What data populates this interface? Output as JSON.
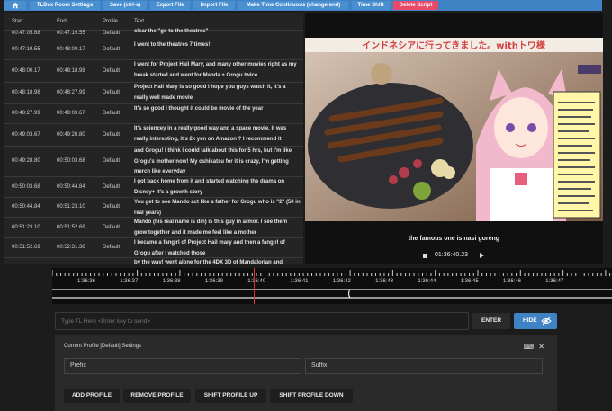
{
  "toolbar": {
    "home_icon": "home-icon",
    "buttons": [
      {
        "label": "TLDex Room Settings"
      },
      {
        "label": "Save (ctrl-s)"
      },
      {
        "label": "Export File"
      },
      {
        "label": "Import File"
      },
      {
        "label": "Make Time Continuous (change end)"
      },
      {
        "label": "Time Shift"
      },
      {
        "label": "Delete Script"
      }
    ],
    "delete_color": "#ea4a6a",
    "accent": "#3f83c4"
  },
  "table": {
    "headers": {
      "start": "Start",
      "end": "End",
      "profile": "Profile",
      "text": "Text"
    },
    "rows": [
      {
        "start": "00:47:05.68",
        "end": "00:47:19.55",
        "profile": "Default",
        "text": "clear the \"go to the theatres\""
      },
      {
        "start": "00:47:19.55",
        "end": "00:48:00.17",
        "profile": "Default",
        "text": "I went to the theatres 7 times!"
      },
      {
        "start": "00:48:00.17",
        "end": "00:48:18.98",
        "profile": "Default",
        "text": "I went for Project Hail Mary, and many other movies right as my break started and went for Manda + Grogu twice"
      },
      {
        "start": "00:48:18.98",
        "end": "00:48:27.99",
        "profile": "Default",
        "text": "Project Hail Mary is so good I hope you guys watch it, it's a really well made movie"
      },
      {
        "start": "00:48:27.99",
        "end": "00:49:03.67",
        "profile": "Default",
        "text": "It's so good I thought it could be movie of the year"
      },
      {
        "start": "00:49:03.67",
        "end": "00:49:28.80",
        "profile": "Default",
        "text": "It's sciencey in a really good way and a space movie. it was really interesting, it's 2k yen on Amazon ? I recommend it"
      },
      {
        "start": "00:49:28.80",
        "end": "00:50:03.68",
        "profile": "Default",
        "text": "and Grogu! I think I could talk about this for 5 hrs, but I'm like Grogu's mother now! My oshikatsu for it is crazy, I'm getting merch like everyday"
      },
      {
        "start": "00:50:03.68",
        "end": "00:50:44.84",
        "profile": "Default",
        "text": "I got back home from it and started watching the drama on Disney+ it's a growth story"
      },
      {
        "start": "00:50:44.84",
        "end": "00:51:23.10",
        "profile": "Default",
        "text": "You get to see Mando act like a father for Grogu who is \"2\" (50 in real years)"
      },
      {
        "start": "00:51:23.10",
        "end": "00:51:52.69",
        "profile": "Default",
        "text": "Mando (his real name is din) is this guy in armor. I see them grow together and it made me feel like a mother"
      },
      {
        "start": "00:51:52.69",
        "end": "00:52:31.38",
        "profile": "Default",
        "text": "I became a fangirl of Project Hail mary and then a fangirl of Grogu after I watched those"
      },
      {
        "start": "",
        "end": "",
        "profile": "",
        "text": "by the way! went alone for the 4DX 3D of Mandalorian and"
      }
    ]
  },
  "video": {
    "title_overlay": "インドネシアに行ってきました。withトワ様",
    "caption": "the famous one is nasi goreng",
    "time": "01:36:40.23"
  },
  "timeline": {
    "ticks": [
      "1:36:36",
      "1:36:37",
      "1:36:38",
      "1:36:39",
      "1:36:40",
      "1:36:41",
      "1:36:42",
      "1:36:43",
      "1:36:44",
      "1:36:45",
      "1:36:46",
      "1:36:47"
    ]
  },
  "input": {
    "placeholder": "Type TL Here <Enter key to send>",
    "enter_label": "ENTER",
    "hide_label": "HIDE"
  },
  "profile": {
    "title": "Current Profile [Default] Settings",
    "prefix_placeholder": "Prefix",
    "suffix_placeholder": "Suffix",
    "buttons": [
      "ADD PROFILE",
      "REMOVE PROFILE",
      "SHIFT PROFILE UP",
      "SHIFT PROFILE DOWN"
    ]
  }
}
